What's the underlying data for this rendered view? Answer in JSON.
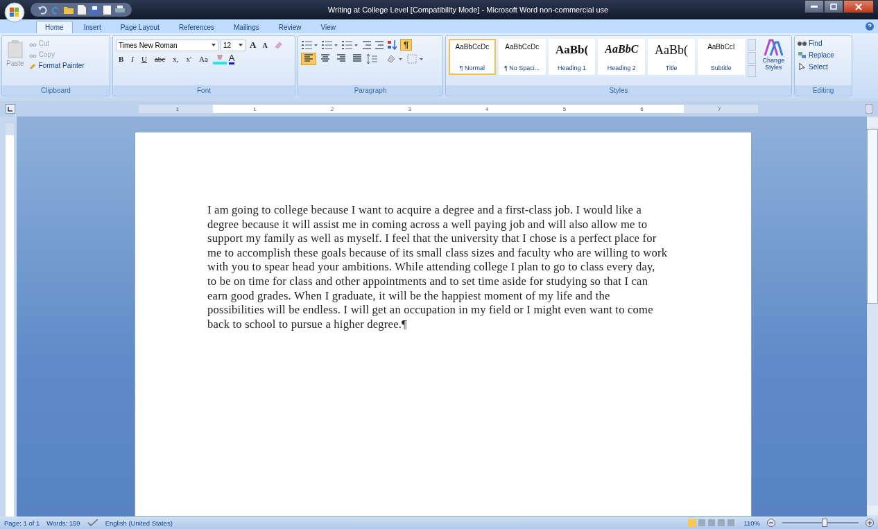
{
  "window": {
    "title": "Writing at College Level [Compatibility Mode] - Microsoft Word non-commercial use"
  },
  "tabs": [
    {
      "label": "Home",
      "selected": true
    },
    {
      "label": "Insert",
      "selected": false
    },
    {
      "label": "Page Layout",
      "selected": false
    },
    {
      "label": "References",
      "selected": false
    },
    {
      "label": "Mailings",
      "selected": false
    },
    {
      "label": "Review",
      "selected": false
    },
    {
      "label": "View",
      "selected": false
    }
  ],
  "clipboard": {
    "label": "Clipboard",
    "paste": "Paste",
    "items": [
      {
        "label": "Cut",
        "disabled": true
      },
      {
        "label": "Copy",
        "disabled": true
      },
      {
        "label": "Format Painter",
        "disabled": false
      }
    ]
  },
  "font": {
    "label": "Font",
    "name": "Times New Roman",
    "size": "12",
    "grow": "A",
    "shrink": "A",
    "format_buttons": [
      {
        "label": "B",
        "kind": "bold"
      },
      {
        "label": "I",
        "kind": "italic"
      },
      {
        "label": "U",
        "kind": "underline"
      },
      {
        "label": "abc",
        "kind": "strike"
      },
      {
        "label": "x,",
        "kind": "sub"
      },
      {
        "label": "x'",
        "kind": "sup"
      },
      {
        "label": "Aa",
        "kind": "case"
      }
    ],
    "color_letter": "A"
  },
  "paragraph": {
    "label": "Paragraph",
    "show_marks": {
      "glyph": "¶",
      "on": true
    },
    "alignments": [
      {
        "selected": true
      },
      {
        "selected": false
      },
      {
        "selected": false
      },
      {
        "selected": false
      }
    ]
  },
  "styles": {
    "label": "Styles",
    "items": [
      {
        "preview": "AaBbCcDc",
        "name": "¶ Normal",
        "kind": "small",
        "selected": true
      },
      {
        "preview": "AaBbCcDc",
        "name": "¶ No Spaci...",
        "kind": "small",
        "selected": false
      },
      {
        "preview": "AaBb(",
        "name": "Heading 1",
        "kind": "large",
        "selected": false
      },
      {
        "preview": "AaBbC",
        "name": "Heading 2",
        "kind": "italic",
        "selected": false
      },
      {
        "preview": "AaBb(",
        "name": "Title",
        "kind": "title",
        "selected": false
      },
      {
        "preview": "AaBbCcI",
        "name": "Subtitle",
        "kind": "small",
        "selected": false
      }
    ],
    "change": "Change Styles"
  },
  "editing": {
    "label": "Editing",
    "items": [
      {
        "label": "Find",
        "kind": "find"
      },
      {
        "label": "Replace",
        "kind": "replace"
      },
      {
        "label": "Select",
        "kind": "select"
      }
    ]
  },
  "ruler": {
    "numbers": [
      "1",
      "1",
      "2",
      "3",
      "4",
      "5",
      "6",
      "7"
    ]
  },
  "document": {
    "lines": [
      "I am going to college because I want to acquire a degree and a first-class job.  I would like a",
      "degree because it will assist me in coming across a well paying job and will also allow me to",
      "support my family as well as myself.  I feel that the university that I chose is a perfect place for",
      "me to accomplish these goals because of its small class sizes and faculty who are willing to work",
      "with you to spear head your ambitions.  While attending college I plan to go to class every day,",
      "to be on time for class and other appointments and to set time aside for studying so that I can",
      "earn good grades.  When I graduate, it will be the happiest moment of my life and the",
      "possibilities will be endless.  I will get an occupation in my field or I might even want to come",
      "back to school to pursue a higher degree.¶"
    ]
  },
  "status_bar": {
    "page": "Page: 1 of 1",
    "words": "Words: 159",
    "language": "English (United States)",
    "zoom": "110%",
    "level": 0.55
  }
}
